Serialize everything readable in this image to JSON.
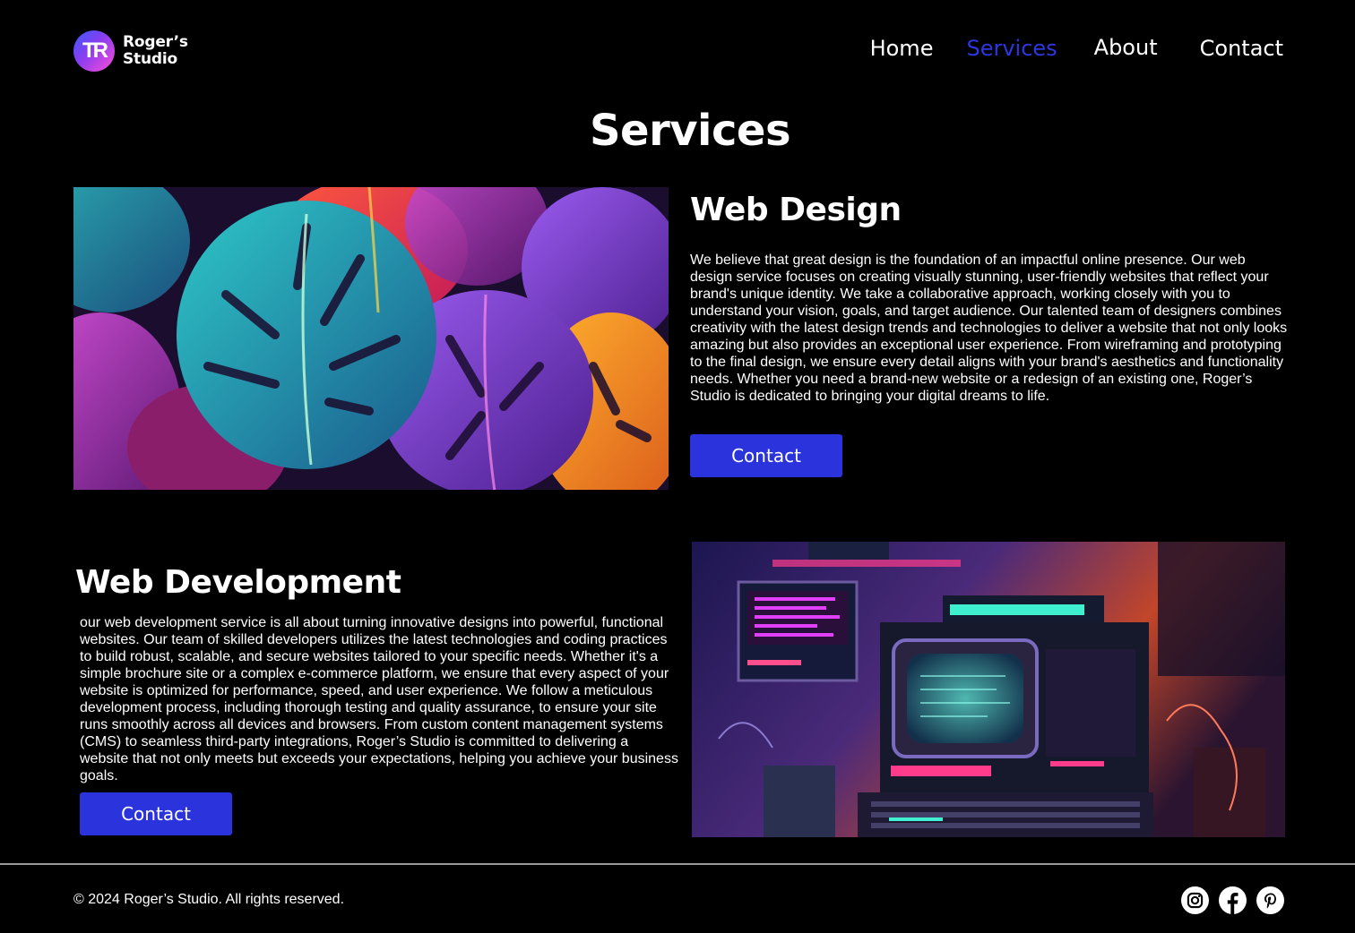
{
  "brand": {
    "logo_glyph": "TR",
    "name_line1": "Roger’s",
    "name_line2": "Studio"
  },
  "nav": {
    "items": [
      {
        "label": "Home"
      },
      {
        "label": "Services",
        "active": true
      },
      {
        "label": "About"
      },
      {
        "label": "Contact"
      }
    ],
    "active_color": "#2d36e0"
  },
  "page": {
    "title": "Services"
  },
  "sections": [
    {
      "title": "Web Design",
      "body": "We believe that great design is the foundation of an impactful online presence. Our web design service focuses on creating visually stunning, user-friendly websites that reflect your brand's unique identity. We take a collaborative approach, working closely with you to understand your vision, goals, and target audience. Our talented team of designers combines creativity with the latest design trends and technologies to deliver a website that not only looks amazing but also provides an exceptional user experience. From wireframing and prototyping to the final design, we ensure every detail aligns with your brand's aesthetics and functionality needs. Whether you need a brand-new website or a redesign of an existing one, Roger’s Studio is dedicated to bringing your digital dreams to life.",
      "button_label": "Contact",
      "image": "colorful-monstera-leaves-image"
    },
    {
      "title": "Web Development",
      "body": "our web development service is all about turning innovative designs into powerful, functional websites. Our team of skilled developers utilizes the latest technologies and coding practices to build robust, scalable, and secure websites tailored to your specific needs. Whether it's a simple brochure site or a complex e-commerce platform, we ensure that every aspect of your website is optimized for performance, speed, and user experience. We follow a meticulous development process, including thorough testing and quality assurance, to ensure your site runs smoothly across all devices and browsers. From custom content management systems (CMS) to seamless third-party integrations, Roger’s Studio is committed to delivering a website that not only meets but exceeds your expectations, helping you achieve your business goals.",
      "button_label": "Contact",
      "image": "retro-neon-computer-image"
    }
  ],
  "footer": {
    "copyright": "© 2024 Roger’s Studio. All rights reserved.",
    "socials": [
      "instagram-icon",
      "facebook-icon",
      "pinterest-icon"
    ]
  },
  "colors": {
    "background": "#000000",
    "button": "#2a33dc",
    "text": "#ffffff"
  }
}
